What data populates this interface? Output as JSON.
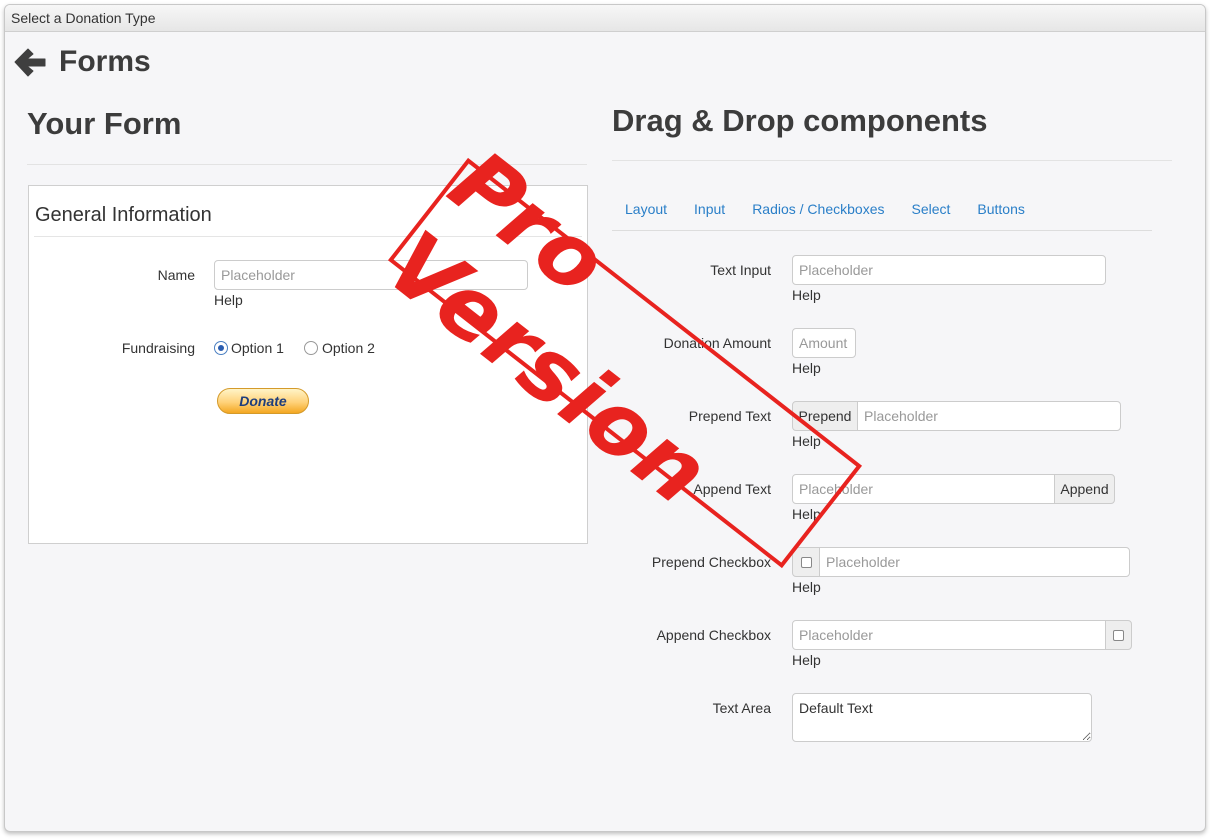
{
  "window": {
    "title": "Select a Donation Type"
  },
  "header": {
    "title": "Forms",
    "back_icon": "arrow-left-icon"
  },
  "your_form": {
    "heading": "Your Form",
    "legend": "General Information",
    "name": {
      "label": "Name",
      "placeholder": "Placeholder",
      "help": "Help"
    },
    "fundraising": {
      "label": "Fundraising",
      "options": [
        "Option 1",
        "Option 2"
      ],
      "selected": "Option 1"
    },
    "donate_button": "Donate"
  },
  "components": {
    "heading": "Drag & Drop components",
    "tabs": [
      "Layout",
      "Input",
      "Radios / Checkboxes",
      "Select",
      "Buttons"
    ],
    "text_input": {
      "label": "Text Input",
      "placeholder": "Placeholder",
      "help": "Help"
    },
    "donation_amount": {
      "label": "Donation Amount",
      "placeholder": "Amount",
      "help": "Help"
    },
    "prepend_text": {
      "label": "Prepend Text",
      "addon": "Prepend",
      "placeholder": "Placeholder",
      "help": "Help"
    },
    "append_text": {
      "label": "Append Text",
      "addon": "Append",
      "placeholder": "Placeholder",
      "help": "Help"
    },
    "prepend_checkbox": {
      "label": "Prepend Checkbox",
      "placeholder": "Placeholder",
      "help": "Help"
    },
    "append_checkbox": {
      "label": "Append Checkbox",
      "placeholder": "Placeholder",
      "help": "Help"
    },
    "text_area": {
      "label": "Text Area",
      "value": "Default Text"
    }
  },
  "stamp": {
    "text": "Pro Version",
    "color": "#e8231f"
  },
  "colors": {
    "link": "#2a7fc8",
    "background": "#f6f6f8"
  }
}
